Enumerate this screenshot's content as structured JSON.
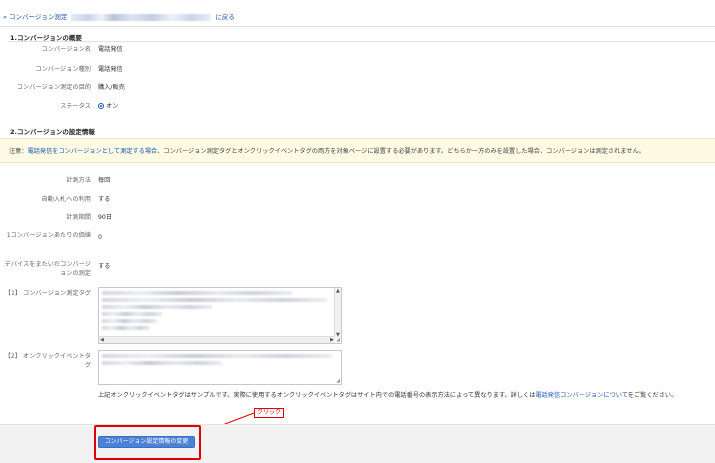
{
  "breadcrumb": {
    "prefix": "« コンバージョン測定",
    "suffix": "に戻る"
  },
  "section1": {
    "title": "1.コンバージョンの概要",
    "rows": [
      {
        "label": "コンバージョン名",
        "value": "電話発信"
      },
      {
        "label": "コンバージョン種別",
        "value": "電話発信"
      },
      {
        "label": "コンバージョン測定の目的",
        "value": "購入/販売"
      },
      {
        "label": "ステータス",
        "value": "オン"
      }
    ]
  },
  "section2": {
    "title": "2.コンバージョンの設定情報",
    "notice": {
      "prefix": "注意：",
      "link": "電話発信をコンバージョンとして測定する場合",
      "middle": "、コンバージョン測定タグとオンクリックイベントタグの両方を対象ページに設置する必要があります。どちらか一方のみを設置した場合、コンバージョンは測定されません。"
    },
    "rows": [
      {
        "label": "計測方法",
        "value": "毎回"
      },
      {
        "label": "自動入札への利用",
        "value": "する"
      },
      {
        "label": "計測期間",
        "value": "90日"
      },
      {
        "label": "1コンバージョンあたりの価値",
        "value": "0"
      },
      {
        "label": "デバイスをまたいだコンバージョンの測定",
        "value": "する"
      }
    ],
    "tag1_label": "【1】 コンバージョン測定タグ",
    "tag2_label": "【2】 オンクリックイベントタグ",
    "sample_note_prefix": "上記オンクリックイベントタグはサンプルです。実際に使用するオンクリックイベントタグはサイト内での電話番号の表示方法によって異なります。詳しくは",
    "sample_note_link": "電話発信コンバージョンについて",
    "sample_note_suffix": "をご覧ください。"
  },
  "footer": {
    "submit_label": "コンバージョン設定情報の変更"
  },
  "annotation": {
    "click_label": "クリック",
    "color": "#e00000"
  },
  "colors": {
    "link": "#1a55b5",
    "primary": "#4b82d8",
    "notice_bg": "#fdfbe3"
  }
}
